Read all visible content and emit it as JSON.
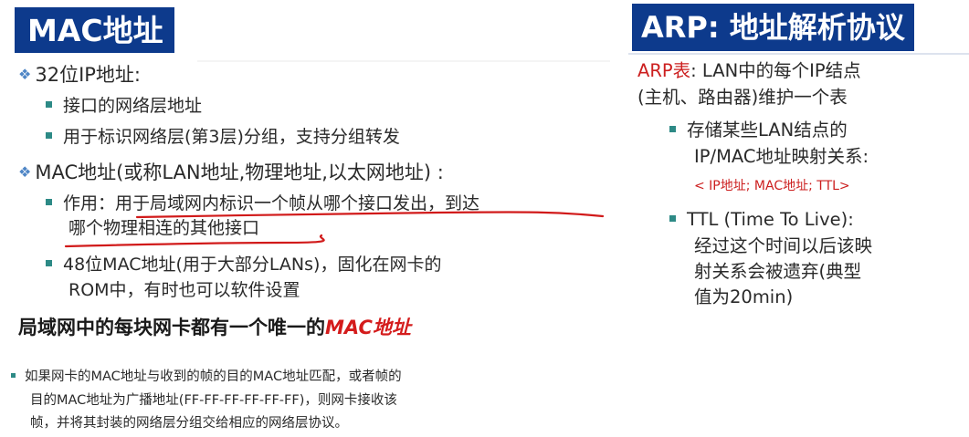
{
  "left": {
    "title": "MAC地址",
    "bullet1": "32位IP地址:",
    "b1_items": [
      "接口的网络层地址",
      "用于标识网络层(第3层)分组，支持分组转发"
    ],
    "bullet2": "MAC地址(或称LAN地址,物理地址,以太网地址) :",
    "b2_item1_line1": "作用：用于局域网内标识一个帧从哪个接口发出，到达",
    "b2_item1_line2": "哪个物理相连的其他接口",
    "b2_item2_line1": "48位MAC地址(用于大部分LANs)，固化在网卡的",
    "b2_item2_line2": "ROM中，有时也可以软件设置",
    "subheading_prefix": "局域网中的每块网卡都有一个唯一的",
    "subheading_em": "MAC地址",
    "note_line1": "如果网卡的MAC地址与收到的帧的目的MAC地址匹配，或者帧的",
    "note_line2": "目的MAC地址为广播地址(FF-FF-FF-FF-FF-FF)，则网卡接收该",
    "note_line3": "帧，并将其封装的网络层分组交给相应的网络层协议。"
  },
  "right": {
    "title": "ARP: 地址解析协议",
    "intro_label": "ARP表",
    "intro_line1_rest": ": LAN中的每个IP结点",
    "intro_line2": "(主机、路由器)维护一个表",
    "item1_line1": "存储某些LAN结点的",
    "item1_line2": "IP/MAC地址映射关系:",
    "item1_line3": "< IP地址; MAC地址; TTL>",
    "item2_line1": "TTL (Time To Live):",
    "item2_line2": "经过这个时间以后该映",
    "item2_line3": "射关系会被遗弃(典型",
    "item2_line4": "值为20min)"
  },
  "colors": {
    "title_bg": "#0d3a8c",
    "accent_red": "#cc1f1f",
    "bullet_teal": "#2d8a86",
    "diamond_blue": "#4f86c6"
  }
}
